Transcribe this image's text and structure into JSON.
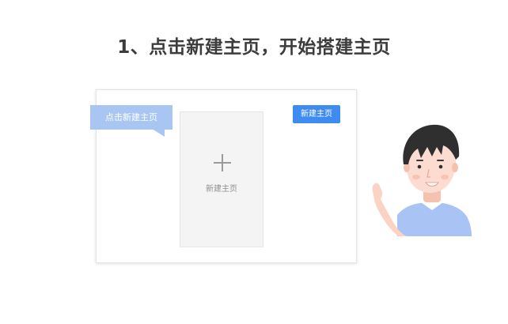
{
  "title": "1、点击新建主页，开始搭建主页",
  "mock_window": {
    "new_button_label": "新建主页",
    "card_label": "新建主页",
    "tooltip_label": "点击新建主页"
  },
  "colors": {
    "accent": "#3f8cf0",
    "tooltip": "#a9c5f1",
    "card_bg": "#f4f4f4",
    "title_text": "#3c3c3c"
  },
  "icons": {
    "card_icon": "plus-icon",
    "illustration": "waving-person-illustration"
  }
}
